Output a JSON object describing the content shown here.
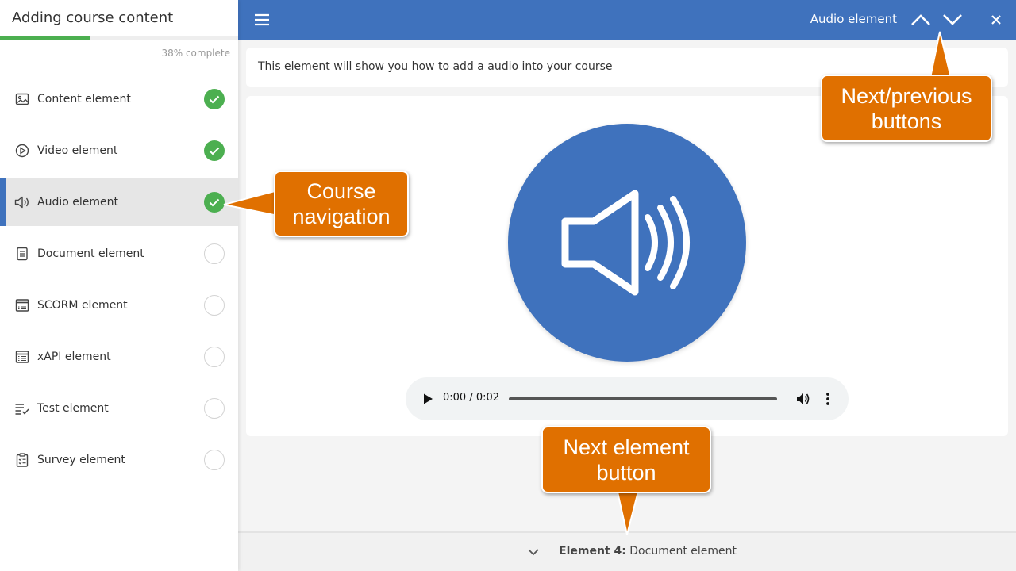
{
  "sidebar": {
    "title": "Adding course content",
    "progress_percent": 38,
    "progress_text": "38% complete",
    "items": [
      {
        "label": "Content element",
        "icon": "image-icon",
        "status": "completed"
      },
      {
        "label": "Video element",
        "icon": "play-circle-icon",
        "status": "completed"
      },
      {
        "label": "Audio element",
        "icon": "speaker-icon",
        "status": "completed",
        "active": true
      },
      {
        "label": "Document element",
        "icon": "document-icon",
        "status": "incomplete"
      },
      {
        "label": "SCORM element",
        "icon": "table-icon",
        "status": "incomplete"
      },
      {
        "label": "xAPI element",
        "icon": "table-icon",
        "status": "incomplete"
      },
      {
        "label": "Test element",
        "icon": "checklist-icon",
        "status": "incomplete"
      },
      {
        "label": "Survey element",
        "icon": "clipboard-icon",
        "status": "incomplete"
      }
    ]
  },
  "topbar": {
    "title": "Audio element",
    "icons": [
      "menu-icon",
      "chevron-up-icon",
      "chevron-down-icon",
      "close-icon"
    ]
  },
  "main": {
    "description": "This element will show you how to add a audio into your course",
    "audio_player": {
      "time": "0:00 / 0:02"
    }
  },
  "footer": {
    "prefix": "Element 4:",
    "next_element": "Document element"
  },
  "callouts": {
    "course_nav": [
      "Course",
      "navigation"
    ],
    "next_prev": [
      "Next/previous",
      "buttons"
    ],
    "next_element": [
      "Next element",
      "button"
    ]
  },
  "colors": {
    "accent": "#3f72bd",
    "success": "#4caf50",
    "callout": "#e07000"
  }
}
